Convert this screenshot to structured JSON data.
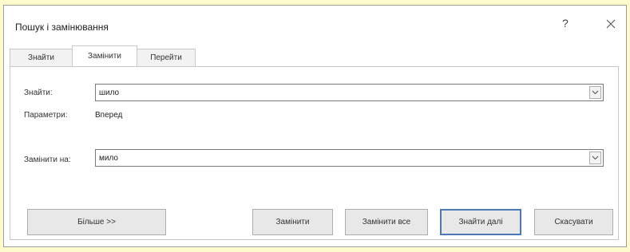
{
  "dialog": {
    "title": "Пошук і замінювання",
    "help_label": "?",
    "tabs": [
      {
        "label": "Знайти",
        "active": false
      },
      {
        "label": "Замінити",
        "active": true
      },
      {
        "label": "Перейти",
        "active": false
      }
    ],
    "find": {
      "label": "Знайти:",
      "value": "шило"
    },
    "options": {
      "label": "Параметри:",
      "value": "Вперед"
    },
    "replace": {
      "label": "Замінити на:",
      "value": "мило"
    },
    "buttons": {
      "more": "Більше >>",
      "replace": "Замінити",
      "replace_all": "Замінити все",
      "find_next": "Знайти далі",
      "cancel": "Скасувати"
    }
  },
  "colors": {
    "background": "#fffbcc",
    "default_button_border": "#4d78b6"
  }
}
